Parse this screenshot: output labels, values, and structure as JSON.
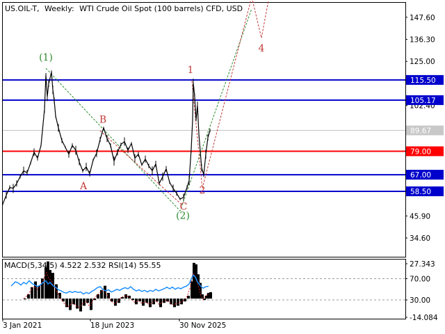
{
  "header": {
    "symbol": "US.OIL-T,",
    "timeframe": "Weekly:",
    "description": "WTI Crude Oil Spot (100 barrels) CFD, USD"
  },
  "chart_data": {
    "type": "line",
    "price_axis": {
      "range": [
        25.0,
        155.0
      ],
      "ticks": [
        "147.60",
        "136.30",
        "125.00",
        "102.40",
        "58.20",
        "45.90",
        "34.60"
      ]
    },
    "time_axis": {
      "labels": [
        "3 Jan 2021",
        "18 Jun 2023",
        "30 Nov 2025"
      ]
    },
    "current_price": "89.67",
    "levels": [
      {
        "value": 115.5,
        "label": "115.50",
        "color": "#0000cc"
      },
      {
        "value": 105.17,
        "label": "105.17",
        "color": "#0000cc"
      },
      {
        "value": 79.0,
        "label": "79.00",
        "color": "#ff0000"
      },
      {
        "value": 67.0,
        "label": "67.00",
        "color": "#0000cc"
      },
      {
        "value": 58.5,
        "label": "58.50",
        "color": "#0000cc"
      }
    ],
    "price_series": [
      [
        0,
        52.0
      ],
      [
        5,
        56.5
      ],
      [
        10,
        60.5
      ],
      [
        15,
        60.0
      ],
      [
        20,
        62.5
      ],
      [
        25,
        66.0
      ],
      [
        30,
        69.0
      ],
      [
        35,
        68.0
      ],
      [
        40,
        73.0
      ],
      [
        45,
        78.5
      ],
      [
        50,
        75.5
      ],
      [
        55,
        82.0
      ],
      [
        60,
        100.5
      ],
      [
        62,
        118.0
      ],
      [
        64,
        107.0
      ],
      [
        66,
        113.5
      ],
      [
        70,
        119.5
      ],
      [
        72,
        110.5
      ],
      [
        74,
        105.0
      ],
      [
        76,
        97.0
      ],
      [
        80,
        91.0
      ],
      [
        85,
        84.5
      ],
      [
        90,
        81.0
      ],
      [
        95,
        77.5
      ],
      [
        100,
        82.0
      ],
      [
        105,
        79.5
      ],
      [
        110,
        73.5
      ],
      [
        115,
        69.0
      ],
      [
        120,
        71.0
      ],
      [
        125,
        67.5
      ],
      [
        130,
        74.5
      ],
      [
        135,
        78.0
      ],
      [
        140,
        85.0
      ],
      [
        145,
        91.0
      ],
      [
        150,
        85.5
      ],
      [
        155,
        82.0
      ],
      [
        160,
        74.0
      ],
      [
        165,
        78.5
      ],
      [
        170,
        82.5
      ],
      [
        175,
        84.0
      ],
      [
        180,
        79.5
      ],
      [
        185,
        83.0
      ],
      [
        190,
        75.5
      ],
      [
        195,
        77.5
      ],
      [
        200,
        72.0
      ],
      [
        205,
        75.0
      ],
      [
        210,
        71.5
      ],
      [
        215,
        69.0
      ],
      [
        220,
        72.5
      ],
      [
        225,
        62.5
      ],
      [
        230,
        66.0
      ],
      [
        235,
        70.0
      ],
      [
        240,
        63.0
      ],
      [
        245,
        60.0
      ],
      [
        250,
        57.5
      ],
      [
        255,
        54.5
      ],
      [
        260,
        55.5
      ],
      [
        265,
        60.5
      ],
      [
        268,
        64.0
      ],
      [
        271,
        80.0
      ],
      [
        273,
        95.0
      ],
      [
        274,
        114.0
      ],
      [
        276,
        107.0
      ],
      [
        278,
        95.0
      ],
      [
        280,
        102.5
      ],
      [
        282,
        88.0
      ],
      [
        284,
        79.0
      ],
      [
        286,
        70.5
      ],
      [
        289,
        67.0
      ],
      [
        292,
        77.5
      ],
      [
        295,
        86.0
      ],
      [
        298,
        89.67
      ]
    ],
    "wave_labels": [
      {
        "text": "(1)",
        "color": "#2e8b2e",
        "anchor": [
          62,
          125.5
        ]
      },
      {
        "text": "(2)",
        "color": "#2e8b2e",
        "anchor": [
          259,
          44.5
        ]
      },
      {
        "text": "A",
        "color": "#c23a3a",
        "anchor": [
          116,
          59.5
        ]
      },
      {
        "text": "B",
        "color": "#c23a3a",
        "anchor": [
          144,
          93.5
        ]
      },
      {
        "text": "C",
        "color": "#c23a3a",
        "anchor": [
          260,
          49.0
        ]
      },
      {
        "text": "1",
        "color": "#c23a3a",
        "anchor": [
          270,
          119.0
        ]
      },
      {
        "text": "2",
        "color": "#c23a3a",
        "anchor": [
          287,
          57.5
        ]
      },
      {
        "text": "4",
        "color": "#c23a3a",
        "anchor": [
          372,
          130.0
        ]
      }
    ],
    "wave_lines": [
      {
        "color": "#2e8b2e",
        "points": [
          [
            62,
            121.5
          ],
          [
            255,
            48.5
          ],
          [
            358,
            152.0
          ]
        ]
      },
      {
        "color": "#c23a3a",
        "points": [
          [
            140,
            89.5
          ],
          [
            258,
            51.5
          ]
        ]
      },
      {
        "color": "#c23a3a",
        "points": [
          [
            272,
            115.0
          ],
          [
            287,
            60.0
          ],
          [
            358,
            158.0
          ],
          [
            372,
            137.0
          ],
          [
            382,
            156.0
          ]
        ]
      }
    ]
  },
  "indicator": {
    "title": "MACD(5,34,5) 4.522 2.532 RSI(14) 55.55",
    "range": [
      -14.084,
      27.343
    ],
    "ticks": [
      "27.343",
      "70.00",
      "30.00",
      "-14.084"
    ],
    "macd_series": [
      [
        30,
        0
      ],
      [
        35,
        3
      ],
      [
        40,
        8
      ],
      [
        45,
        12
      ],
      [
        50,
        9
      ],
      [
        55,
        14
      ],
      [
        60,
        22
      ],
      [
        63,
        26
      ],
      [
        66,
        20
      ],
      [
        70,
        18
      ],
      [
        75,
        10
      ],
      [
        80,
        4
      ],
      [
        85,
        -2
      ],
      [
        90,
        -6
      ],
      [
        95,
        -8
      ],
      [
        100,
        -4
      ],
      [
        105,
        -7
      ],
      [
        110,
        -9
      ],
      [
        115,
        -5
      ],
      [
        120,
        -3
      ],
      [
        125,
        -8
      ],
      [
        130,
        -1
      ],
      [
        135,
        3
      ],
      [
        140,
        6
      ],
      [
        145,
        9
      ],
      [
        150,
        4
      ],
      [
        155,
        -2
      ],
      [
        160,
        -5
      ],
      [
        165,
        -3
      ],
      [
        170,
        1
      ],
      [
        175,
        3
      ],
      [
        180,
        2
      ],
      [
        185,
        -1
      ],
      [
        190,
        -4
      ],
      [
        195,
        -2
      ],
      [
        200,
        -5
      ],
      [
        205,
        -3
      ],
      [
        210,
        -6
      ],
      [
        215,
        -4
      ],
      [
        220,
        -2
      ],
      [
        225,
        -6
      ],
      [
        230,
        -3
      ],
      [
        235,
        -2
      ],
      [
        240,
        -4
      ],
      [
        245,
        -6
      ],
      [
        250,
        -5
      ],
      [
        255,
        -4
      ],
      [
        260,
        -2
      ],
      [
        265,
        2
      ],
      [
        270,
        12
      ],
      [
        273,
        25
      ],
      [
        276,
        24
      ],
      [
        279,
        17
      ],
      [
        282,
        11
      ],
      [
        285,
        3
      ],
      [
        288,
        -1
      ],
      [
        291,
        2
      ],
      [
        294,
        4
      ],
      [
        297,
        4.5
      ]
    ],
    "rsi_series": [
      [
        12,
        56
      ],
      [
        15,
        60
      ],
      [
        18,
        64
      ],
      [
        22,
        62
      ],
      [
        26,
        58
      ],
      [
        30,
        63
      ],
      [
        34,
        60
      ],
      [
        38,
        66
      ],
      [
        42,
        61
      ],
      [
        46,
        58
      ],
      [
        50,
        55
      ],
      [
        54,
        58
      ],
      [
        58,
        63
      ],
      [
        62,
        66
      ],
      [
        65,
        60
      ],
      [
        68,
        63
      ],
      [
        72,
        57
      ],
      [
        76,
        54
      ],
      [
        80,
        49
      ],
      [
        84,
        47
      ],
      [
        88,
        44
      ],
      [
        92,
        43
      ],
      [
        96,
        46
      ],
      [
        100,
        44
      ],
      [
        104,
        46
      ],
      [
        108,
        44
      ],
      [
        112,
        45
      ],
      [
        116,
        41
      ],
      [
        120,
        44
      ],
      [
        124,
        42
      ],
      [
        128,
        46
      ],
      [
        132,
        49
      ],
      [
        136,
        53
      ],
      [
        140,
        55
      ],
      [
        144,
        50
      ],
      [
        148,
        47
      ],
      [
        152,
        49
      ],
      [
        156,
        45
      ],
      [
        160,
        47
      ],
      [
        164,
        50
      ],
      [
        168,
        48
      ],
      [
        172,
        51
      ],
      [
        176,
        53
      ],
      [
        180,
        51
      ],
      [
        184,
        55
      ],
      [
        188,
        50
      ],
      [
        192,
        47
      ],
      [
        196,
        49
      ],
      [
        200,
        46
      ],
      [
        204,
        48
      ],
      [
        208,
        45
      ],
      [
        212,
        48
      ],
      [
        216,
        46
      ],
      [
        220,
        50
      ],
      [
        224,
        47
      ],
      [
        228,
        49
      ],
      [
        232,
        51
      ],
      [
        236,
        54
      ],
      [
        240,
        51
      ],
      [
        244,
        54
      ],
      [
        248,
        50
      ],
      [
        252,
        53
      ],
      [
        256,
        51
      ],
      [
        260,
        54
      ],
      [
        264,
        56
      ],
      [
        268,
        60
      ],
      [
        272,
        72
      ],
      [
        274,
        77
      ],
      [
        277,
        73
      ],
      [
        280,
        64
      ],
      [
        284,
        57
      ],
      [
        288,
        52
      ],
      [
        292,
        55
      ],
      [
        296,
        55.55
      ]
    ],
    "levels": [
      70.0,
      30.0
    ]
  },
  "colors": {
    "price": "#000000",
    "rsi": "#1e90ff",
    "macd": "#000000",
    "macd_signal": "#d02020",
    "grid_dash": "#999999",
    "current_price_badge": "#c8c8c8"
  }
}
